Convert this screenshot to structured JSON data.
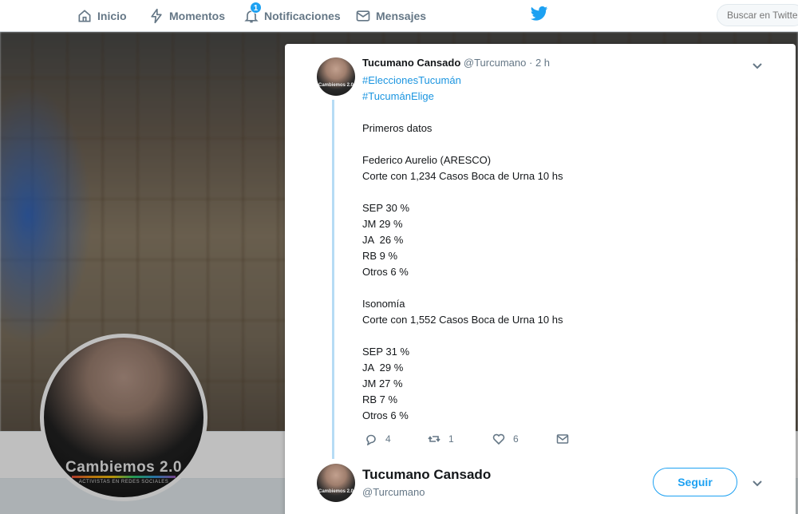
{
  "nav": {
    "home": "Inicio",
    "moments": "Momentos",
    "notifications": "Notificaciones",
    "notifications_badge": "1",
    "messages": "Mensajes",
    "search_placeholder": "Buscar en Twitter"
  },
  "profile": {
    "avatar_caption": "Cambiemos 2.0",
    "avatar_subcaption": "ACTIVISTAS EN REDES SOCIALES"
  },
  "tweet": {
    "author_name": "Tucumano Cansado",
    "author_handle": "@Turcumano",
    "separator": " · ",
    "time": "2 h",
    "avatar_caption": "Cambiemos 2.0",
    "hashtags": [
      "#EleccionesTucumán",
      "#TucumánElige"
    ],
    "lines": [
      "",
      "Primeros datos",
      "",
      "Federico Aurelio (ARESCO)",
      "Corte con 1,234 Casos Boca de Urna 10 hs",
      "",
      "SEP 30 %",
      "JM 29 %",
      "JA  26 %",
      "RB 9 %",
      "Otros 6 %",
      "",
      "Isonomía",
      "Corte con 1,552 Casos Boca de Urna 10 hs",
      "",
      "SEP 31 %",
      "JA  29 %",
      "JM 27 %",
      "RB 7 %",
      "Otros 6 %"
    ],
    "replies": "4",
    "retweets": "1",
    "likes": "6"
  },
  "user_card": {
    "name": "Tucumano Cansado",
    "handle": "@Turcumano",
    "follow_label": "Seguir",
    "avatar_caption": "Cambiemos 2.0"
  },
  "colors": {
    "accent": "#1da1f2",
    "hashtag": "#1b95e0",
    "thread_line": "#b6dcf5",
    "muted": "#657786"
  }
}
